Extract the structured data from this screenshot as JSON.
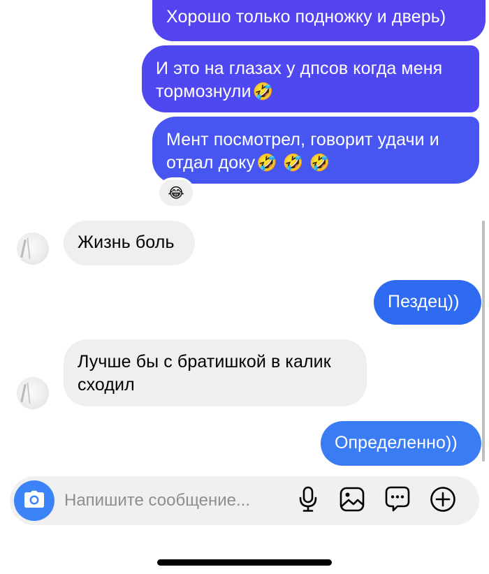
{
  "messages": [
    {
      "id": "b1",
      "direction": "outgoing",
      "text": "Хорошо только подножку и дверь)",
      "emoji": ""
    },
    {
      "id": "b2",
      "direction": "outgoing",
      "text": "И это на глазах у дпсов когда меня тормознули",
      "emoji": "🤣"
    },
    {
      "id": "b3",
      "direction": "outgoing",
      "text": "Мент посмотрел, говорит удачи и отдал доку",
      "emoji": "🤣 🤣 🤣"
    },
    {
      "id": "b4",
      "direction": "incoming",
      "text": "Жизнь боль"
    },
    {
      "id": "b5",
      "direction": "outgoing",
      "text": "Пездец))"
    },
    {
      "id": "b6",
      "direction": "incoming",
      "text": "Лучше бы с братишкой в калик сходил"
    },
    {
      "id": "b7",
      "direction": "outgoing",
      "text": "Определенно))"
    }
  ],
  "reaction": {
    "emoji": "😂"
  },
  "composer": {
    "placeholder": "Напишите сообщение...",
    "icons": [
      "camera-icon",
      "microphone-icon",
      "gallery-icon",
      "sticker-icon",
      "plus-icon"
    ]
  },
  "colors": {
    "outgoing_top": "#5444f0",
    "outgoing_bottom": "#3a7cf4",
    "incoming": "#efefef",
    "composer_bg": "#f0f0f0",
    "camera_button": "#3b83f6"
  }
}
